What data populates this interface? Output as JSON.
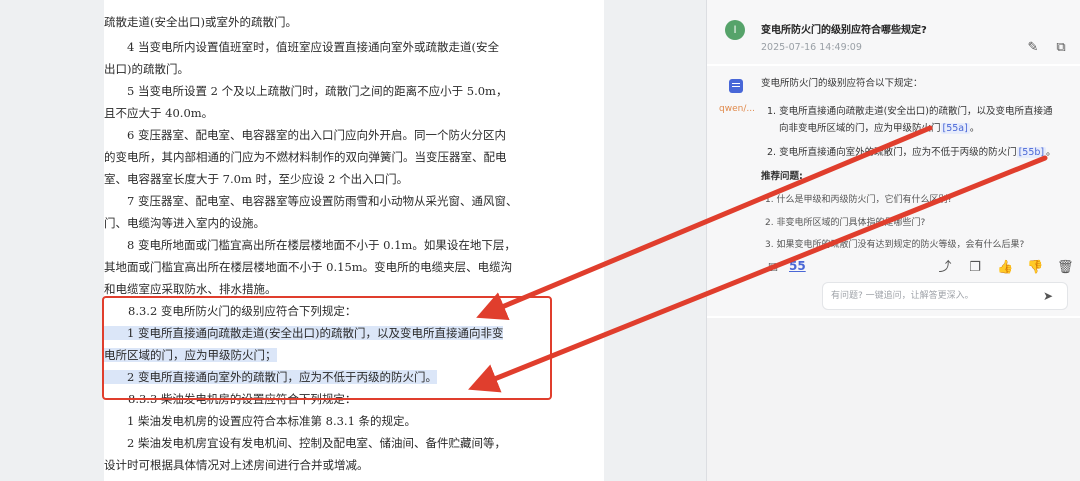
{
  "document": {
    "lines": [
      "疏散走道(安全出口)或室外的疏散门。",
      "　　4 当变电所内设置值班室时，值班室应设置直接通向室外或疏散走道(安全",
      "出口)的疏散门。",
      "　　5 当变电所设置 2 个及以上疏散门时，疏散门之间的距离不应小于 5.0m，",
      "且不应大于 40.0m。",
      "　　6 变压器室、配电室、电容器室的出入口门应向外开启。同一个防火分区内",
      "的变电所，其内部相通的门应为不燃材料制作的双向弹簧门。当变压器室、配电",
      "室、电容器室长度大于 7.0m 时，至少应设 2 个出入口门。",
      "　　7 变压器室、配电室、电容器室等应设置防雨雪和小动物从采光窗、通风窗、",
      "门、电缆沟等进入室内的设施。",
      "　　8 变电所地面或门槛宜高出所在楼层楼地面不小于 0.1m。如果设在地下层，",
      "其地面或门槛宜高出所在楼层楼地面不小于 0.15m。变电所的电缆夹层、电缆沟",
      "和电缆室应采取防水、排水措施。",
      "8.3.2  变电所防火门的级别应符合下列规定：",
      "　　1 变电所直接通向疏散走道(安全出口)的疏散门，以及变电所直接通向非变",
      "电所区域的门，应为甲级防火门；",
      "　　2 变电所直接通向室外的疏散门，应为不低于丙级的防火门。",
      "8.3.3  柴油发电机房的设置应符合下列规定：",
      "　　1 柴油发电机房的设置应符合本标准第 8.3.1 条的规定。",
      "　　2 柴油发电机房宜设有发电机间、控制及配电室、储油间、备件贮藏间等，",
      "设计时可根据具体情况对上述房间进行合并或增减。"
    ]
  },
  "chat": {
    "user_avatar": "I",
    "question": "变电所防火门的级别应符合哪些规定?",
    "timestamp": "2025-07-16 14:49:09",
    "model": "qwen/...",
    "answer_intro": "变电所防火门的级别应符合以下规定：",
    "answer_1a": "1. 变电所直接通向疏散走道(安全出口)的疏散门，以及变电所直接通",
    "answer_1b": "向非变电所区域的门，应为甲级防火门",
    "cite_1": "[55a]",
    "answer_1_end": "。",
    "answer_2": "2. 变电所直接通向室外的疏散门，应为不低于丙级的防火门",
    "cite_2": "[55b]",
    "answer_2_end": "。",
    "recommend_title": "推荐问题:",
    "recommendations": [
      "1. 什么是甲级和丙级防火门，它们有什么区别?",
      "2. 非变电所区域的门具体指的是哪些门?",
      "3. 如果变电所的疏散门没有达到规定的防火等级，会有什么后果?"
    ],
    "source_count": "55",
    "input_placeholder": "有问题? 一键追问，让解答更深入。"
  },
  "colors": {
    "accent": "#4a67d6",
    "annotation_red": "#e03e2d",
    "highlight": "#dbe6f8"
  },
  "icons": [
    "edit-icon",
    "copy-icon",
    "doc-icon",
    "sources-icon",
    "share-icon",
    "duplicate-icon",
    "thumbs-up-icon",
    "thumbs-down-icon",
    "trash-icon",
    "send-icon"
  ]
}
